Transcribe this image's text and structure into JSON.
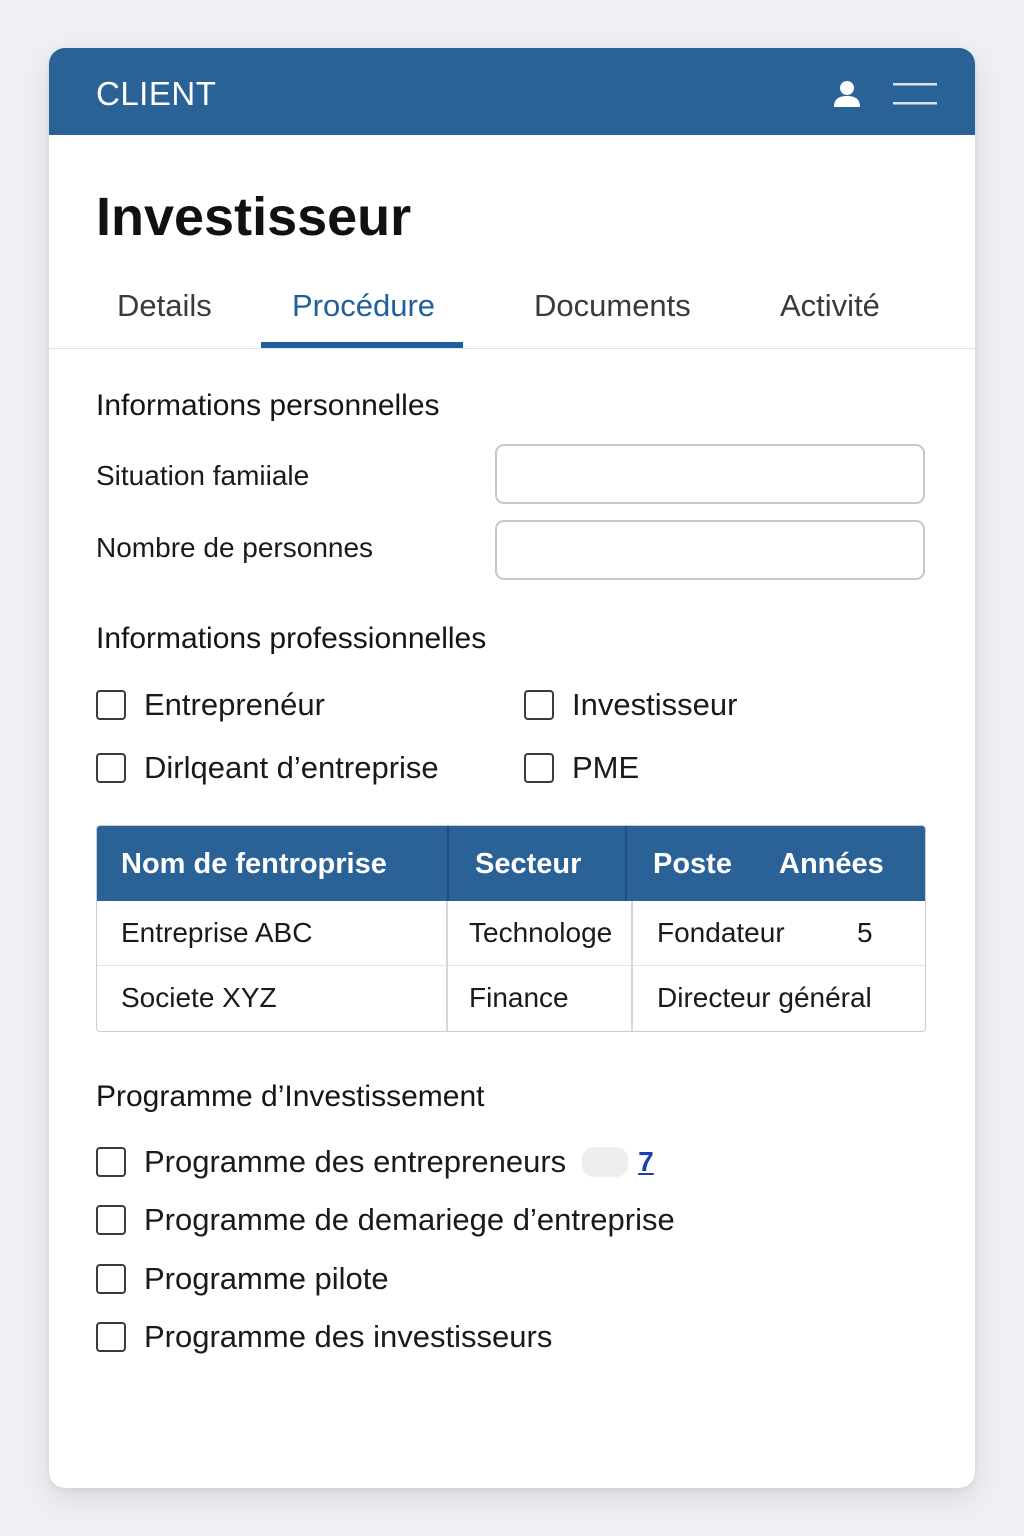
{
  "header": {
    "app_title": "CLIENT",
    "user_icon": "user-icon",
    "menu_icon": "hamburger-menu-icon"
  },
  "page": {
    "title": "Investisseur"
  },
  "tabs": [
    {
      "label": "Details",
      "active": false
    },
    {
      "label": "Procédure",
      "active": true
    },
    {
      "label": "Documents",
      "active": false
    },
    {
      "label": "Activité",
      "active": false
    }
  ],
  "personal": {
    "section_title": "Informations personnelles",
    "fields": [
      {
        "label": "Situation famiiale",
        "value": ""
      },
      {
        "label": "Nombre de personnes",
        "value": ""
      }
    ]
  },
  "professional": {
    "section_title": "Informations professionnelles",
    "checkboxes": [
      {
        "label": "Entreprenéur",
        "checked": false
      },
      {
        "label": "Investisseur",
        "checked": false
      },
      {
        "label": "Dirlqeant d’entreprise",
        "checked": false
      },
      {
        "label": "PME",
        "checked": false
      }
    ]
  },
  "table": {
    "headers": [
      "Nom de fentroprise",
      "Secteur",
      "Poste",
      "Années"
    ],
    "rows": [
      [
        "Entreprise ABC",
        "Technologe",
        "Fondateur",
        "5"
      ],
      [
        "Societe XYZ",
        "Finance",
        "Directeur général",
        ""
      ]
    ]
  },
  "program": {
    "section_title": "Programme d’Investissement",
    "checkboxes": [
      {
        "label": "Programme des entrepreneurs",
        "checked": false
      },
      {
        "label": "Programme de demariege d’entreprise",
        "checked": false
      },
      {
        "label": "Programme pilote",
        "checked": false
      },
      {
        "label": "Programme des investisseurs",
        "checked": false
      }
    ],
    "link_text": "7"
  },
  "colors": {
    "header_bg": "#2a6298",
    "accent": "#1f5f9e",
    "link": "#1f3fb0"
  }
}
